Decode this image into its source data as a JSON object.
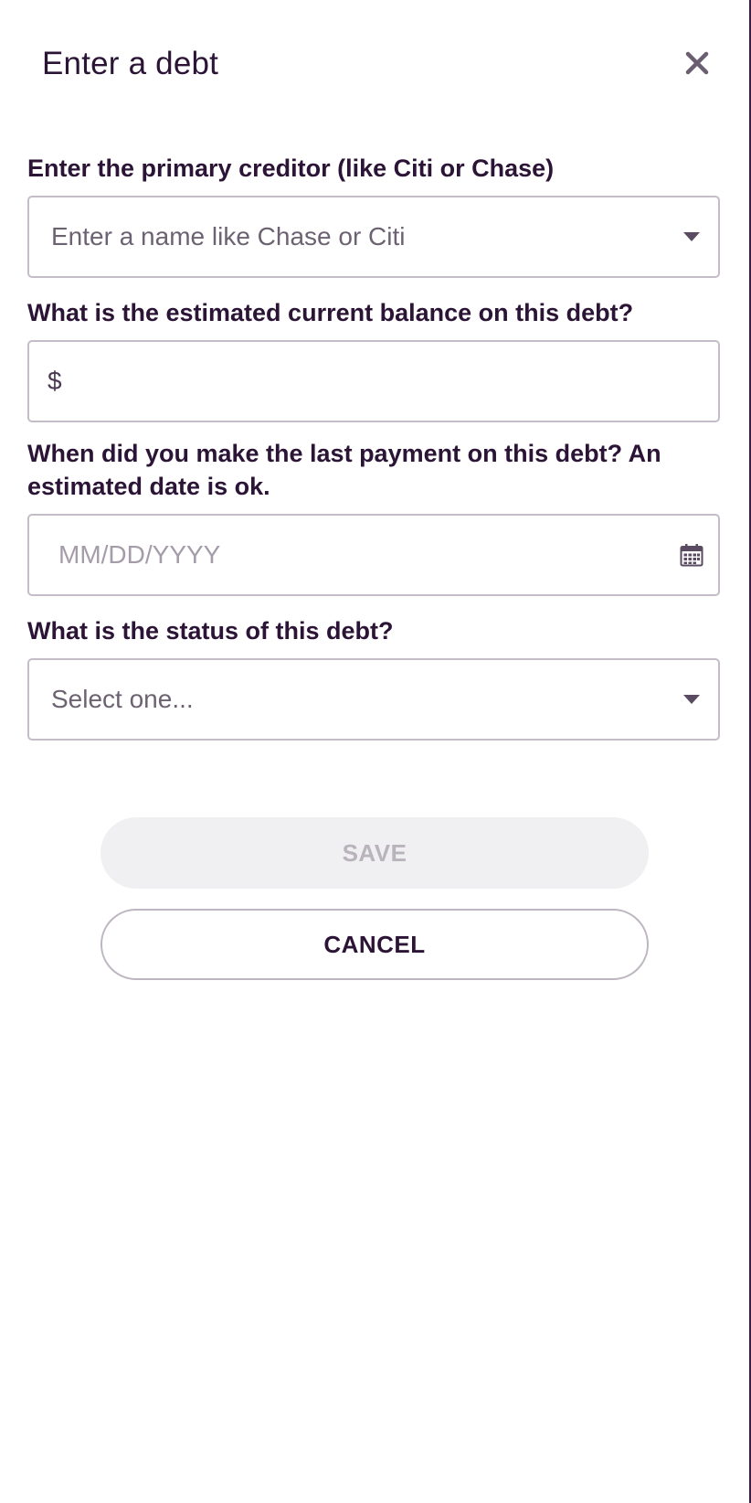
{
  "header": {
    "title": "Enter a debt",
    "close_icon": "close-icon"
  },
  "creditor": {
    "label": "Enter the primary creditor (like Citi or Chase)",
    "placeholder": "Enter a name like Chase or Citi",
    "icon": "chevron-down-icon"
  },
  "balance": {
    "label": "What is the estimated current balance on this debt?",
    "prefix": "$",
    "value": ""
  },
  "last_payment": {
    "label": "When did you make the last payment on this debt? An estimated date is ok.",
    "placeholder": "MM/DD/YYYY",
    "icon": "calendar-icon"
  },
  "status": {
    "label": "What is the status of this debt?",
    "selected": "Select one...",
    "icon": "chevron-down-icon"
  },
  "actions": {
    "save_label": "SAVE",
    "cancel_label": "CANCEL"
  },
  "colors": {
    "text": "#2b1436",
    "border": "#c4bdc8",
    "save_bg": "#f0eff1",
    "save_text": "#b9b3bc"
  }
}
